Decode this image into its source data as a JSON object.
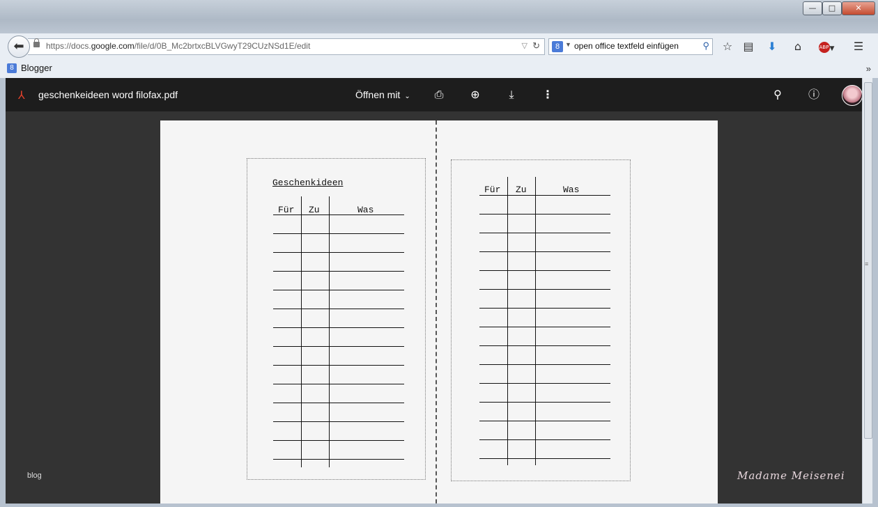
{
  "window": {
    "controls": {
      "minimize": "—",
      "maximize": "□",
      "close": "✕"
    }
  },
  "navbar": {
    "back_icon": "arrow-left-icon",
    "url_prefix": "https://docs.",
    "url_domain": "google.com",
    "url_suffix": "/file/d/0B_Mc2brtxcBLVGwyT29CUzNSd1E/edit",
    "search_engine_letter": "8",
    "search_query": "open office textfeld einfügen"
  },
  "bookmarks": {
    "items": [
      {
        "label": "Blogger",
        "icon_letter": "8"
      }
    ],
    "overflow": "»"
  },
  "viewer": {
    "filename": "geschenkeideen word filofax.pdf",
    "open_with": "Öffnen mit"
  },
  "page": {
    "left_card": {
      "title": "Geschenkideen",
      "headers": [
        "Für",
        "Zu",
        "Was"
      ],
      "row_count": 13
    },
    "right_card": {
      "headers": [
        "Für",
        "Zu",
        "Was"
      ],
      "row_count": 14
    }
  },
  "overlay": {
    "blog_label": "blog",
    "signature": "Madame Meisenei"
  }
}
